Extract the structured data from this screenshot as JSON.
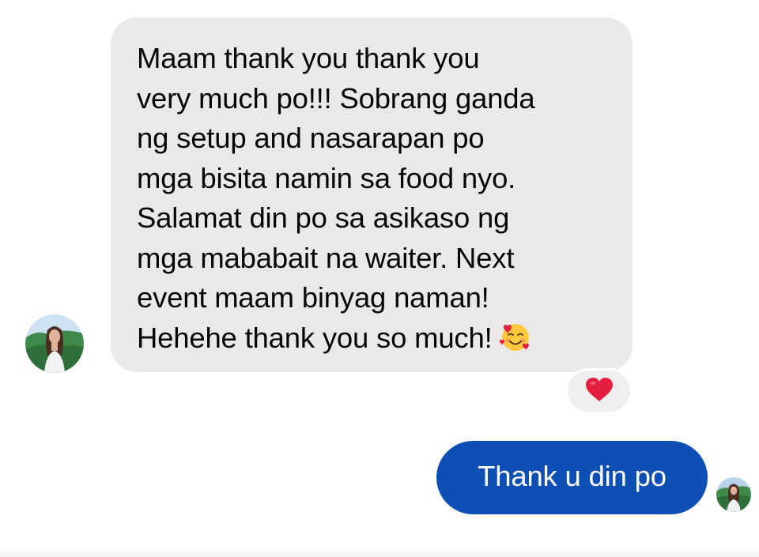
{
  "conversation": {
    "incoming": {
      "lines": [
        "Maam thank you thank you",
        "very much po!!! Sobrang ganda",
        "ng setup and nasarapan po",
        "mga bisita namin sa food nyo.",
        "Salamat din po sa asikaso ng",
        "mga mababait na waiter. Next",
        "event maam binyag naman!",
        "Hehehe thank you so much!"
      ],
      "emoji": "smiling-face-with-hearts-icon",
      "bubble_color": "#e9e9ea",
      "text_color": "#050505",
      "avatar": "contact-avatar"
    },
    "reaction": {
      "icon": "red-heart-icon",
      "color": "#e41e3f"
    },
    "outgoing": {
      "text": "Thank u din po",
      "bubble_color": "#0d4fb4",
      "text_color": "#ffffff",
      "read_receipt": "seen-avatar"
    }
  }
}
